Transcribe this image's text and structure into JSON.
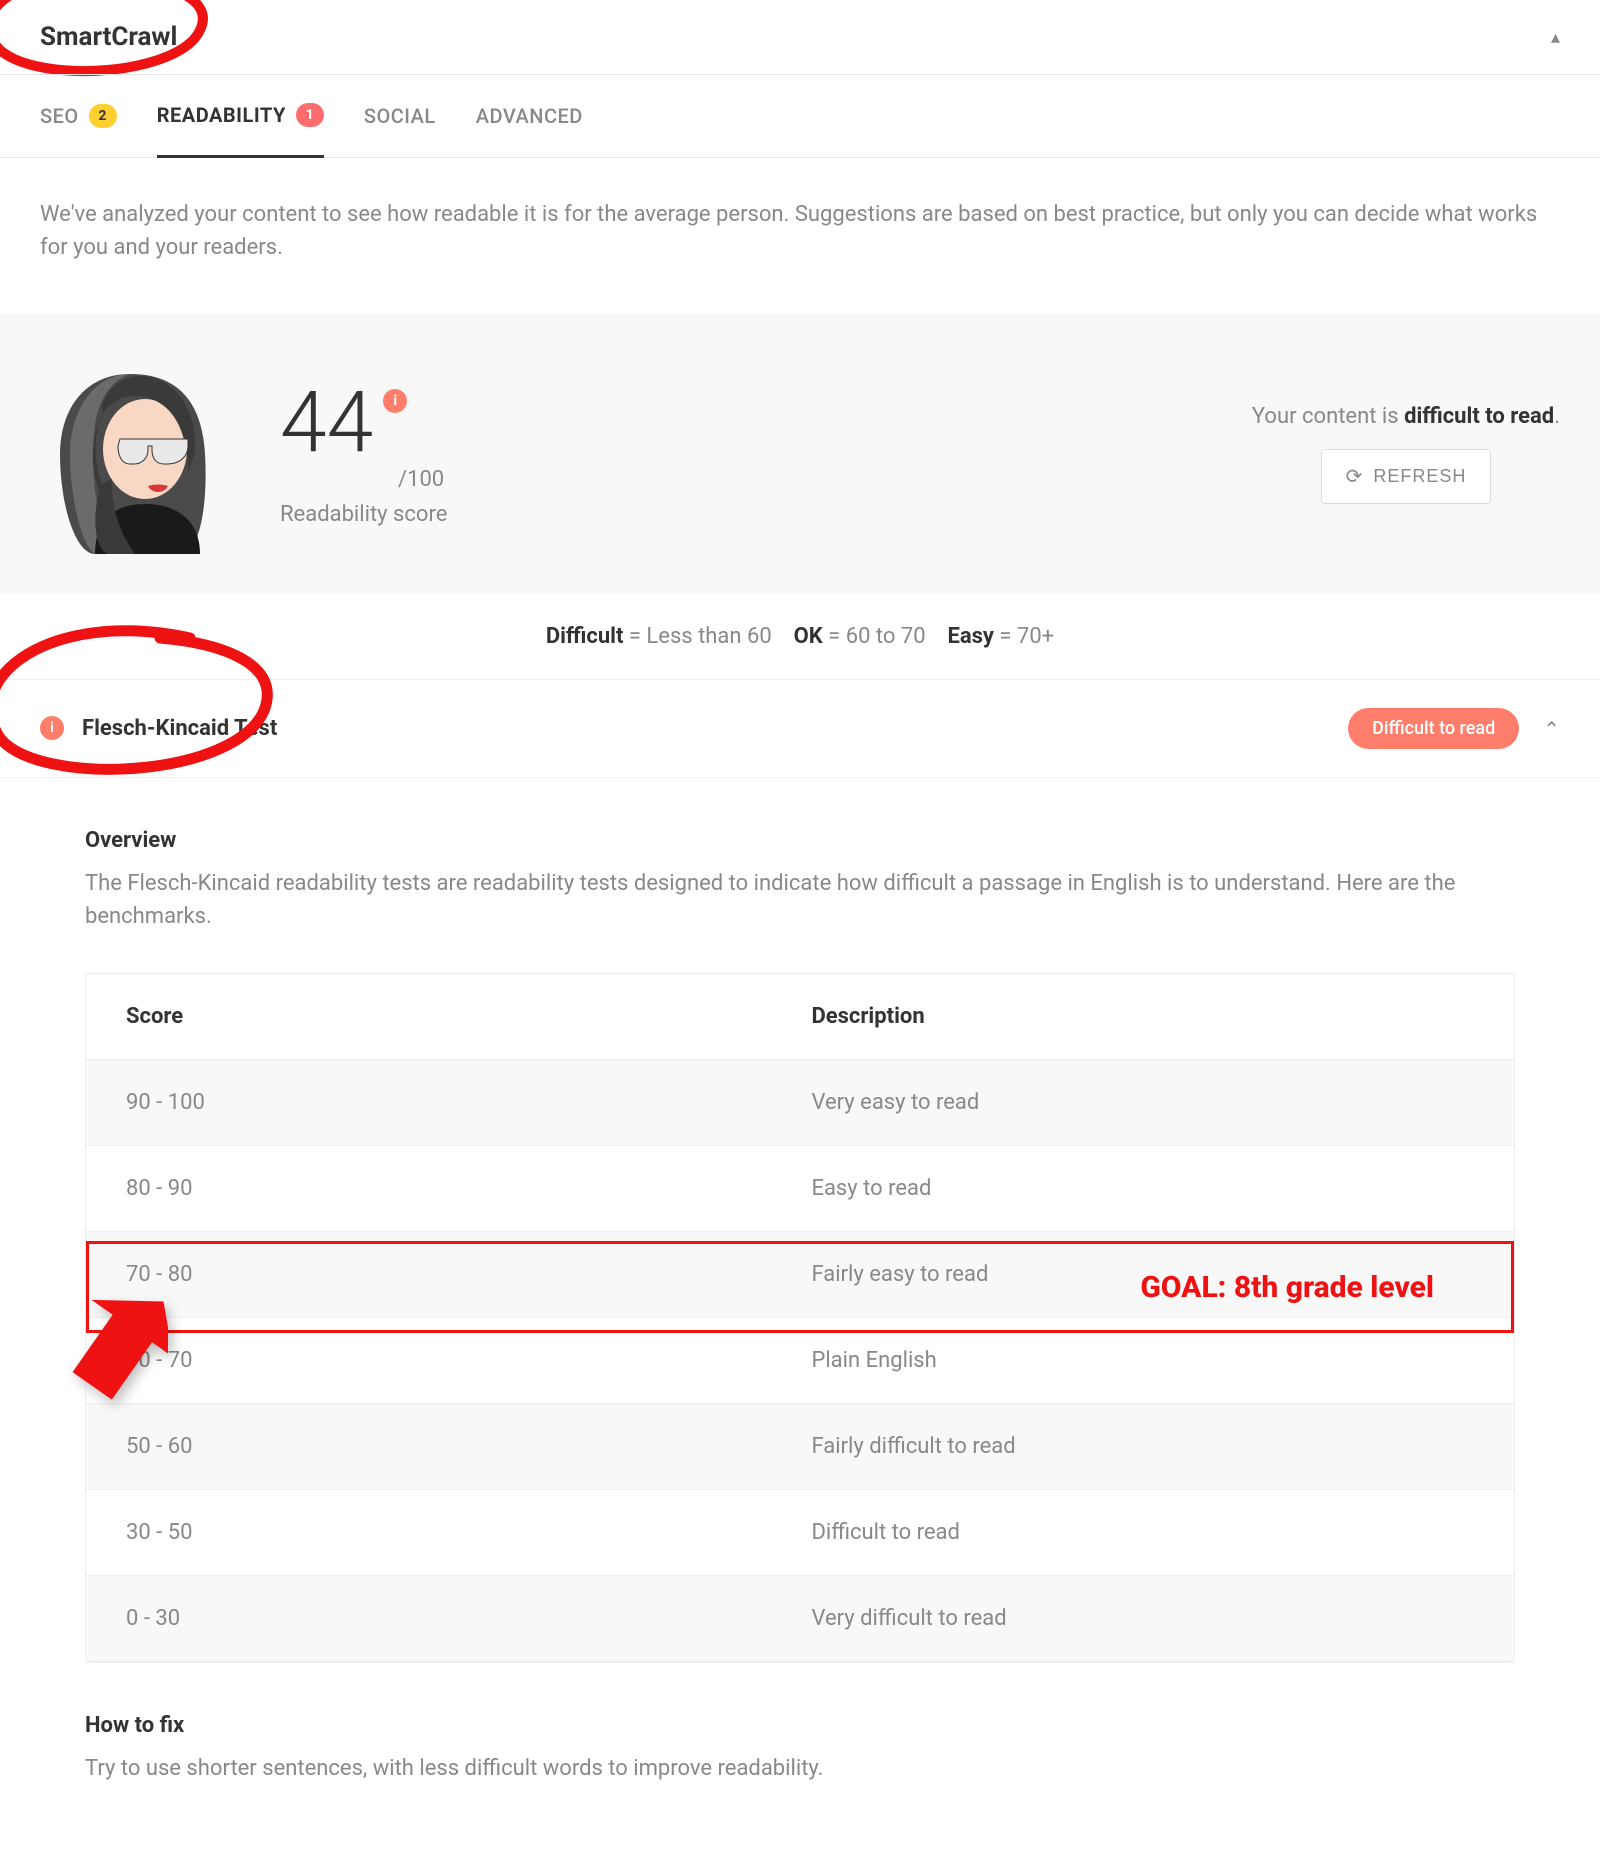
{
  "app": {
    "title": "SmartCrawl"
  },
  "tabs": {
    "seo": {
      "label": "SEO",
      "badge": "2"
    },
    "readability": {
      "label": "READABILITY",
      "badge": "1"
    },
    "social": {
      "label": "SOCIAL"
    },
    "advanced": {
      "label": "ADVANCED"
    }
  },
  "intro": "We've analyzed your content to see how readable it is for the average person. Suggestions are based on best practice, but only you can decide what works for you and your readers.",
  "score": {
    "value": "44",
    "total": "/100",
    "label": "Readability score",
    "info_glyph": "i"
  },
  "status": {
    "prefix": "Your content is ",
    "strong": "difficult to read",
    "suffix": ".",
    "refresh": "REFRESH"
  },
  "legend": {
    "diff_label": "Difficult",
    "diff_val": " = Less than 60",
    "ok_label": "OK",
    "ok_val": " = 60 to 70",
    "easy_label": "Easy",
    "easy_val": " = 70+"
  },
  "accordion": {
    "title": "Flesch-Kincaid Test",
    "pill": "Difficult to read",
    "info_glyph": "i"
  },
  "overview": {
    "heading": "Overview",
    "text": "The Flesch-Kincaid readability tests are readability tests designed to indicate how difficult a passage in English is to understand. Here are the benchmarks.",
    "col_score": "Score",
    "col_desc": "Description",
    "rows": [
      {
        "score": "90 - 100",
        "desc": "Very easy to read"
      },
      {
        "score": "80 - 90",
        "desc": "Easy to read"
      },
      {
        "score": "70 - 80",
        "desc": "Fairly easy to read"
      },
      {
        "score": "60 - 70",
        "desc": "Plain English"
      },
      {
        "score": "50 - 60",
        "desc": "Fairly difficult to read"
      },
      {
        "score": "30 - 50",
        "desc": "Difficult to read"
      },
      {
        "score": "0 - 30",
        "desc": "Very difficult to read"
      }
    ]
  },
  "howto": {
    "heading": "How to fix",
    "text": "Try to use shorter sentences, with less difficult words to improve readability."
  },
  "annotations": {
    "goal": "GOAL: 8th grade level"
  }
}
